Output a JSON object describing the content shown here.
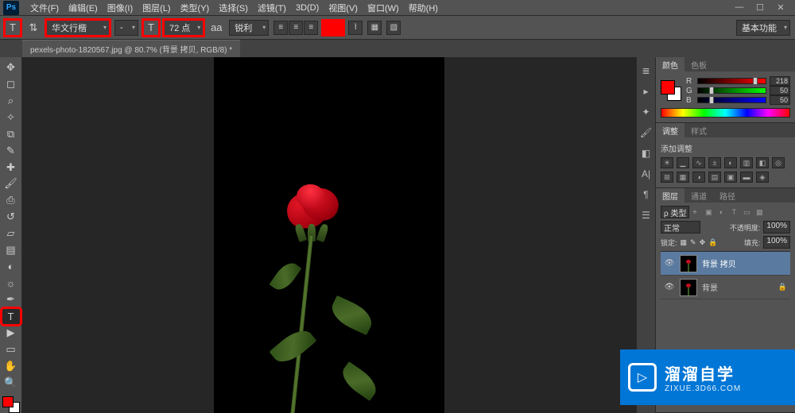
{
  "app": {
    "logo": "Ps"
  },
  "menu": {
    "file": "文件(F)",
    "edit": "编辑(E)",
    "image": "图像(I)",
    "layer": "图层(L)",
    "type": "类型(Y)",
    "select": "选择(S)",
    "filter": "滤镜(T)",
    "threeD": "3D(D)",
    "view": "视图(V)",
    "window": "窗口(W)",
    "help": "帮助(H)"
  },
  "options": {
    "font": "华文行楷",
    "style": "-",
    "size": "72 点",
    "aa_label": "aa",
    "antialias": "锐利",
    "color": "#ff0000",
    "workspace": "基本功能"
  },
  "document": {
    "tab": "pexels-photo-1820567.jpg @ 80.7% (背景 拷贝, RGB/8) *"
  },
  "color_panel": {
    "tab1": "颜色",
    "tab2": "色板",
    "r_label": "R",
    "g_label": "G",
    "b_label": "B",
    "r": "218",
    "g": "50",
    "b": "50"
  },
  "adjust_panel": {
    "tab1": "调整",
    "tab2": "样式",
    "title": "添加调整"
  },
  "layers_panel": {
    "tab1": "图层",
    "tab2": "通道",
    "tab3": "路径",
    "kind": "类型",
    "blend": "正常",
    "opacity_label": "不透明度:",
    "opacity": "100%",
    "lock_label": "锁定:",
    "fill_label": "填充:",
    "fill": "100%",
    "layers": [
      {
        "name": "背景 拷贝",
        "locked": false,
        "selected": true
      },
      {
        "name": "背景",
        "locked": true,
        "selected": false
      }
    ]
  },
  "watermark": {
    "title": "溜溜自学",
    "url": "ZIXUE.3D66.COM"
  },
  "icons": {
    "min": "—",
    "max": "☐",
    "close": "✕",
    "orient": "⇅",
    "align_l": "≡",
    "align_c": "≡",
    "align_r": "≡",
    "warp": "⌇",
    "panel3d": "▦",
    "folder": "▧",
    "eye": "👁",
    "lock": "🔒",
    "play": "▷",
    "kind_arrow": "÷"
  }
}
